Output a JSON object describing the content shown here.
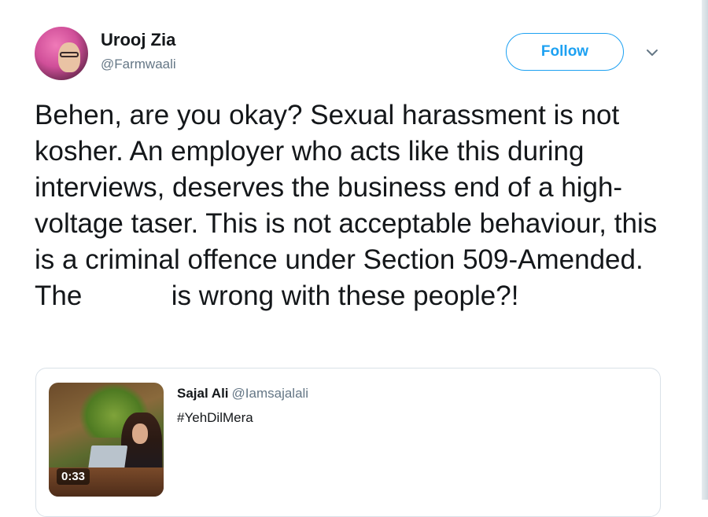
{
  "tweet": {
    "author": {
      "display_name": "Urooj Zia",
      "handle": "@Farmwaali"
    },
    "follow_label": "Follow",
    "text_parts": {
      "before_redaction": "Behen, are you okay? Sexual harassment is not kosher. An employer who acts like this during interviews, deserves the business end of a high-voltage taser. This is not acceptable behaviour, this is a criminal offence under Section 509-Amended. The",
      "after_redaction": "is wrong with these people?!"
    }
  },
  "quoted_tweet": {
    "display_name": "Sajal Ali",
    "handle": "@Iamsajalali",
    "text": "#YehDilMera",
    "video_duration": "0:33"
  },
  "icons": {
    "menu": "chevron-down-icon"
  },
  "colors": {
    "accent": "#1da1f2",
    "secondary_text": "#657786",
    "border": "#d9e1e8"
  }
}
